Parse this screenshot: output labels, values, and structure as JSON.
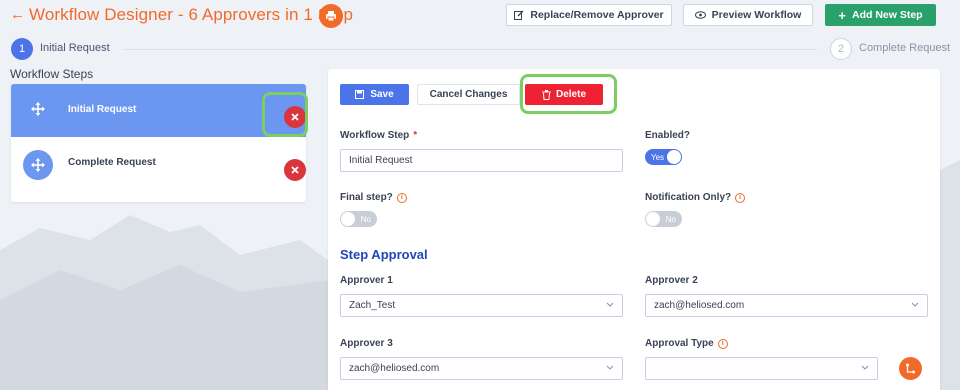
{
  "header": {
    "back_icon": "arrow-left-icon",
    "title": "Workflow Designer - 6 Approvers in 1 Step",
    "print_icon": "print-icon",
    "buttons": {
      "replace_label": "Replace/Remove Approver",
      "preview_label": "Preview Workflow",
      "add_label": "Add New Step"
    }
  },
  "stepper": {
    "steps": [
      {
        "number": "1",
        "label": "Initial Request",
        "state": "active"
      },
      {
        "number": "2",
        "label": "Complete Request",
        "state": "inactive"
      }
    ]
  },
  "sidebar": {
    "heading": "Workflow Steps",
    "items": [
      {
        "label": "Initial Request",
        "selected": true
      },
      {
        "label": "Complete Request",
        "selected": false
      }
    ]
  },
  "form": {
    "actions": {
      "save_label": "Save",
      "cancel_label": "Cancel Changes",
      "delete_label": "Delete"
    },
    "workflow_step_label": "Workflow Step",
    "required_mark": "*",
    "workflow_step_value": "Initial Request",
    "enabled_label": "Enabled?",
    "enabled_value": "Yes",
    "final_step_label": "Final step?",
    "final_step_value": "No",
    "notification_only_label": "Notification Only?",
    "notification_only_value": "No",
    "section_title": "Step Approval",
    "approver1_label": "Approver 1",
    "approver1_value": "Zach_Test",
    "approver2_label": "Approver 2",
    "approver2_value": "zach@heliosed.com",
    "approver3_label": "Approver 3",
    "approver3_value": "zach@heliosed.com",
    "approval_type_label": "Approval Type",
    "approval_type_value": ""
  },
  "colors": {
    "accent_orange": "#f26a2a",
    "primary_blue": "#4a74e8",
    "delete_red": "#ee2233",
    "add_green": "#2aa06a",
    "highlight_green": "#7ccd63"
  }
}
